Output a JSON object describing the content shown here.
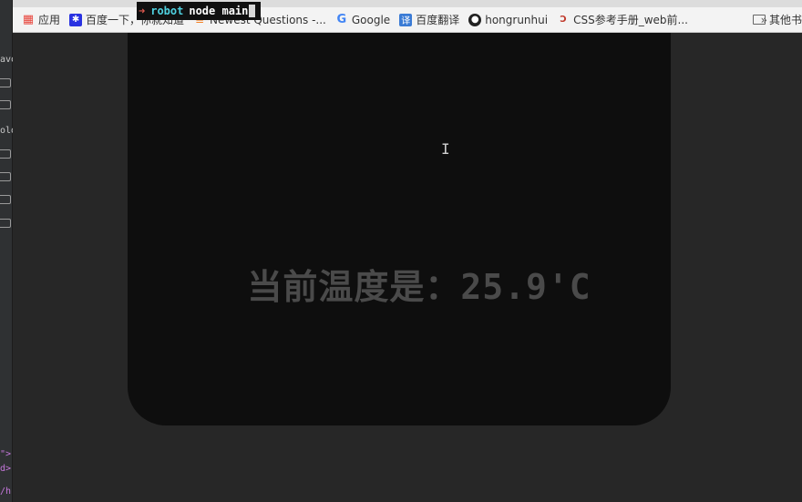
{
  "terminal": {
    "prompt_symbol": "➜",
    "directory": "robot",
    "command": "node main"
  },
  "bookmarks": [
    {
      "label": "应用",
      "icon": "apps-grid-icon",
      "color": "#e8453c"
    },
    {
      "label": "百度一下，你就知道",
      "icon": "baidu-paw-icon",
      "color": "#2932e1"
    },
    {
      "label": "Newest Questions -...",
      "icon": "stackoverflow-icon",
      "color": "#f48024"
    },
    {
      "label": "Google",
      "icon": "google-g-icon",
      "color": "#4285f4"
    },
    {
      "label": "百度翻译",
      "icon": "baidu-translate-icon",
      "color": "#3a7bd5"
    },
    {
      "label": "hongrunhui",
      "icon": "github-icon",
      "color": "#222222"
    },
    {
      "label": "CSS参考手册_web前...",
      "icon": "css-ref-icon",
      "color": "#c0392b"
    }
  ],
  "bookmarks_more": "»",
  "bookmarks_other": "其他书",
  "display": {
    "temperature_text": "当前温度是：25.9'C"
  },
  "left_strip": {
    "labels": [
      "avo",
      "olde"
    ],
    "code_lines": [
      "\">",
      "d>",
      "/h"
    ]
  }
}
